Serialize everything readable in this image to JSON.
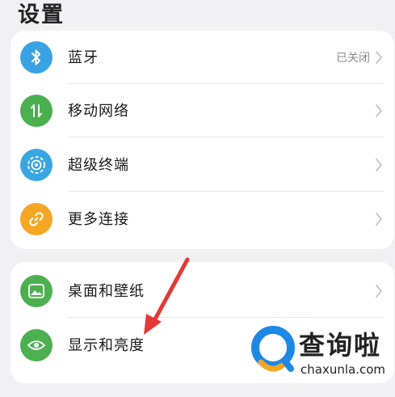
{
  "header": {
    "title": "设置"
  },
  "group1": [
    {
      "label": "蓝牙",
      "status": "已关闭",
      "icon": "bluetooth-icon",
      "color": "#3aa3e3"
    },
    {
      "label": "移动网络",
      "icon": "mobile-network-icon",
      "color": "#4caf50"
    },
    {
      "label": "超级终端",
      "icon": "super-device-icon",
      "color": "#38a6e0"
    },
    {
      "label": "更多连接",
      "icon": "link-icon",
      "color": "#f5a623"
    }
  ],
  "group2": [
    {
      "label": "桌面和壁纸",
      "icon": "wallpaper-icon",
      "color": "#4caf50"
    },
    {
      "label": "显示和亮度",
      "icon": "eye-icon",
      "color": "#4caf50"
    }
  ],
  "watermark": {
    "text": "查询啦",
    "sub": "chaxunla.com",
    "logo": "magnifier-logo",
    "accent": "#1e88e5",
    "accent2": "#f5a623"
  },
  "annotation": {
    "arrow_color": "#e53935"
  }
}
